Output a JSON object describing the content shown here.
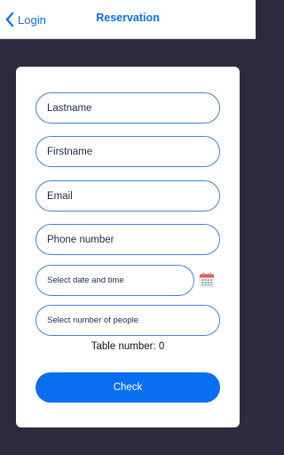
{
  "navbar": {
    "back_label": "Login",
    "title": "Reservation"
  },
  "form": {
    "lastname_placeholder": "Lastname",
    "firstname_placeholder": "Firstname",
    "email_placeholder": "Email",
    "phone_placeholder": "Phone number",
    "datetime_placeholder": "Select date and time",
    "people_placeholder": "Select number of people",
    "table_number_text": "Table number: 0",
    "check_label": "Check",
    "calendar_icon": "calendar-icon"
  },
  "colors": {
    "accent": "#0a6ef0",
    "background": "#2b2b3d",
    "field_border": "#3d84d9",
    "calendar_red": "#e25b5b"
  }
}
